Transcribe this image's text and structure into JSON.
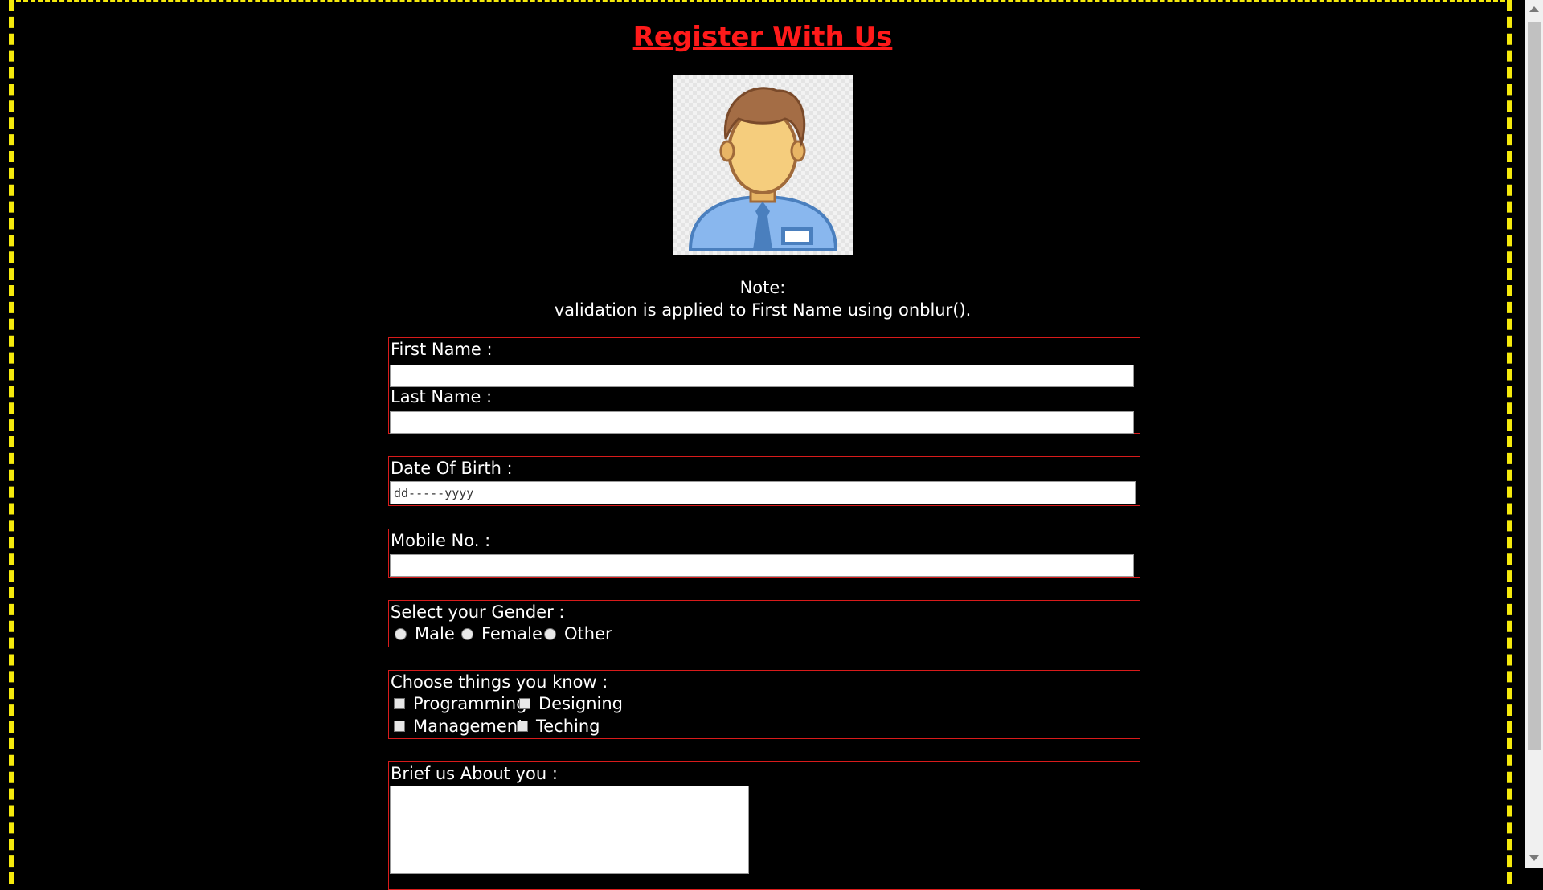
{
  "page": {
    "title": "Register With Us",
    "note_heading": "Note:",
    "note_text": "validation is applied to First Name using onblur()."
  },
  "form": {
    "name": {
      "first_label": "First Name :",
      "first_value": "",
      "last_label": "Last Name :",
      "last_value": ""
    },
    "dob": {
      "label": "Date Of Birth :",
      "placeholder": "dd-----yyyy"
    },
    "mobile": {
      "label": "Mobile No. :",
      "value": ""
    },
    "gender": {
      "label": "Select your Gender :",
      "options": [
        "Male",
        "Female",
        "Other"
      ]
    },
    "skills": {
      "label": "Choose things you know :",
      "options": [
        "Programming",
        "Designing",
        "Management",
        "Teching"
      ]
    },
    "about": {
      "label": "Brief us About you :",
      "value": ""
    }
  },
  "colors": {
    "frame_border": "#f5e90c",
    "accent": "#ff1a1a",
    "box_border": "#d81b1b",
    "background": "#000000"
  },
  "icons": {
    "avatar": "user-avatar-icon"
  }
}
